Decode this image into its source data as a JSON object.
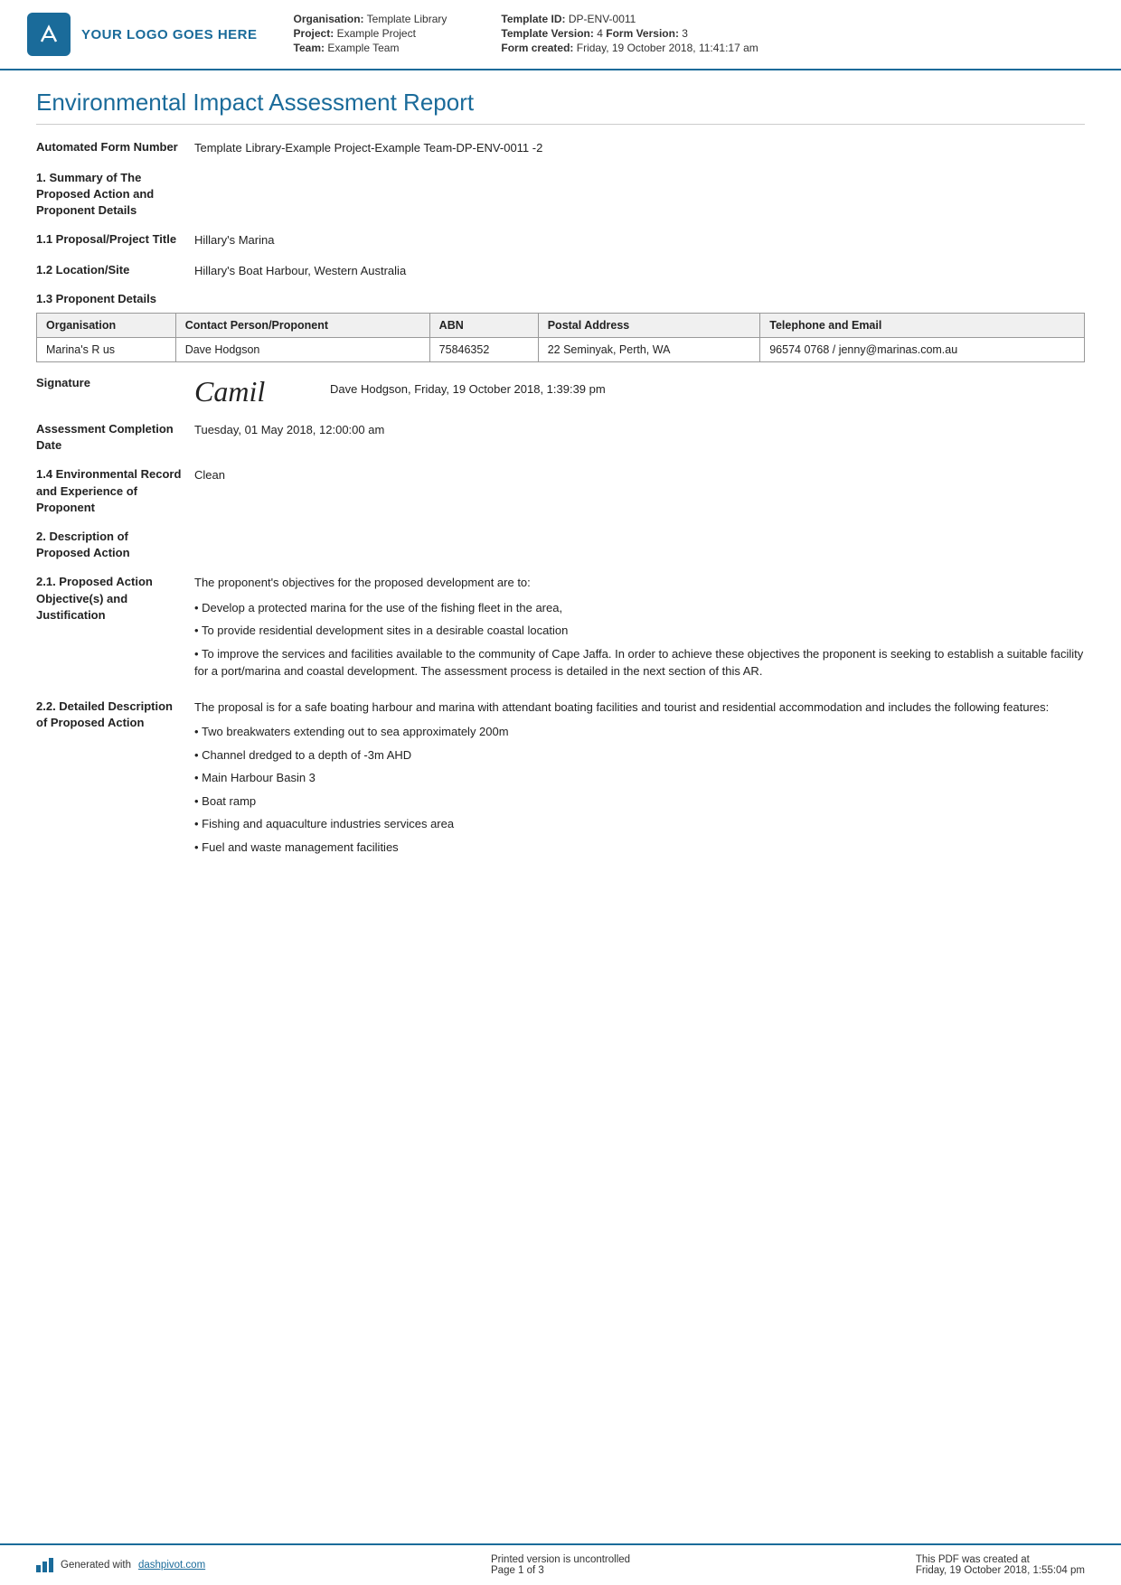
{
  "header": {
    "logo_text": "YOUR LOGO GOES HERE",
    "meta_left": {
      "organisation_label": "Organisation:",
      "organisation_value": "Template Library",
      "project_label": "Project:",
      "project_value": "Example Project",
      "team_label": "Team:",
      "team_value": "Example Team"
    },
    "meta_right": {
      "template_id_label": "Template ID:",
      "template_id_value": "DP-ENV-0011",
      "template_version_label": "Template Version:",
      "template_version_value": "4",
      "form_version_label": "Form Version:",
      "form_version_value": "3",
      "form_created_label": "Form created:",
      "form_created_value": "Friday, 19 October 2018, 11:41:17 am"
    }
  },
  "report": {
    "title": "Environmental Impact Assessment Report",
    "automated_form_number_label": "Automated Form Number",
    "automated_form_number_value": "Template Library-Example Project-Example Team-DP-ENV-0011  -2",
    "section1_label": "1. Summary of The Proposed Action and Proponent Details",
    "section1_1_label": "1.1 Proposal/Project Title",
    "section1_1_value": "Hillary's Marina",
    "section1_2_label": "1.2 Location/Site",
    "section1_2_value": "Hillary's Boat Harbour, Western Australia",
    "section1_3_label": "1.3 Proponent Details",
    "table_headers": [
      "Organisation",
      "Contact Person/Proponent",
      "ABN",
      "Postal Address",
      "Telephone and Email"
    ],
    "table_rows": [
      {
        "organisation": "Marina's R us",
        "contact": "Dave Hodgson",
        "abn": "75846352",
        "postal_address": "22 Seminyak, Perth, WA",
        "telephone_email": "96574 0768 / jenny@marinas.com.au"
      }
    ],
    "signature_label": "Signature",
    "signature_cursive": "Camil",
    "signature_text": "Dave Hodgson, Friday, 19 October 2018, 1:39:39 pm",
    "assessment_completion_label": "Assessment Completion Date",
    "assessment_completion_value": "Tuesday, 01 May 2018, 12:00:00 am",
    "section1_4_label": "1.4 Environmental Record and Experience of Proponent",
    "section1_4_value": "Clean",
    "section2_label": "2. Description of Proposed Action",
    "section2_1_label": "2.1. Proposed Action Objective(s) and Justification",
    "section2_1_intro": "The proponent's objectives for the proposed development are to:",
    "section2_1_bullets": [
      "Develop a protected marina for the use of the fishing fleet in the area,",
      "To provide residential development sites in a desirable coastal location",
      "To improve the services and facilities available to the community of Cape Jaffa. In order to achieve these objectives the proponent is seeking to establish a suitable facility for a port/marina and coastal development. The assessment process is detailed in the next section of this AR."
    ],
    "section2_2_label": "2.2. Detailed Description of Proposed Action",
    "section2_2_intro": "The proposal is for a safe boating harbour and marina with attendant boating facilities and tourist and residential accommodation and includes the following features:",
    "section2_2_bullets": [
      "Two breakwaters extending out to sea approximately 200m",
      "Channel dredged to a depth of -3m AHD",
      "Main Harbour Basin 3",
      "Boat ramp",
      "Fishing and aquaculture industries services area",
      "Fuel and waste management facilities"
    ]
  },
  "footer": {
    "generated_text": "Generated with ",
    "dashpivot_link": "dashpivot.com",
    "middle_text": "Printed version is uncontrolled",
    "page_label": "Page 1 of 3",
    "right_text": "This PDF was created at",
    "right_date": "Friday, 19 October 2018, 1:55:04 pm"
  }
}
